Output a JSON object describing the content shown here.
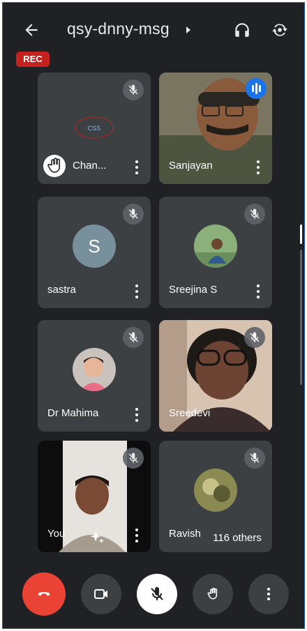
{
  "header": {
    "meeting_code": "qsy-dnny-msg",
    "rec_badge": "REC"
  },
  "tiles": [
    {
      "name": "Chan...",
      "avatar_text": "CSS",
      "muted": true,
      "hand_raised": true
    },
    {
      "name": "Sanjayan",
      "muted": false,
      "speaking": true
    },
    {
      "name": "sastra",
      "avatar_letter": "S",
      "muted": true
    },
    {
      "name": "Sreejina S",
      "muted": true
    },
    {
      "name": "Dr Mahima",
      "muted": true
    },
    {
      "name": "Sreedevi",
      "muted": true
    },
    {
      "name": "You",
      "muted": true
    },
    {
      "name": "Ravish",
      "muted": true
    }
  ],
  "others_count": "116 others",
  "controls": {
    "end_call": "end-call",
    "camera": "camera",
    "mic": "mic-off",
    "hand": "raise-hand",
    "more": "more-options"
  },
  "colors": {
    "background": "#202124",
    "tile": "#3c4043",
    "accent": "#1a73e8",
    "rec": "#c5221f",
    "end_call": "#ea4335"
  }
}
